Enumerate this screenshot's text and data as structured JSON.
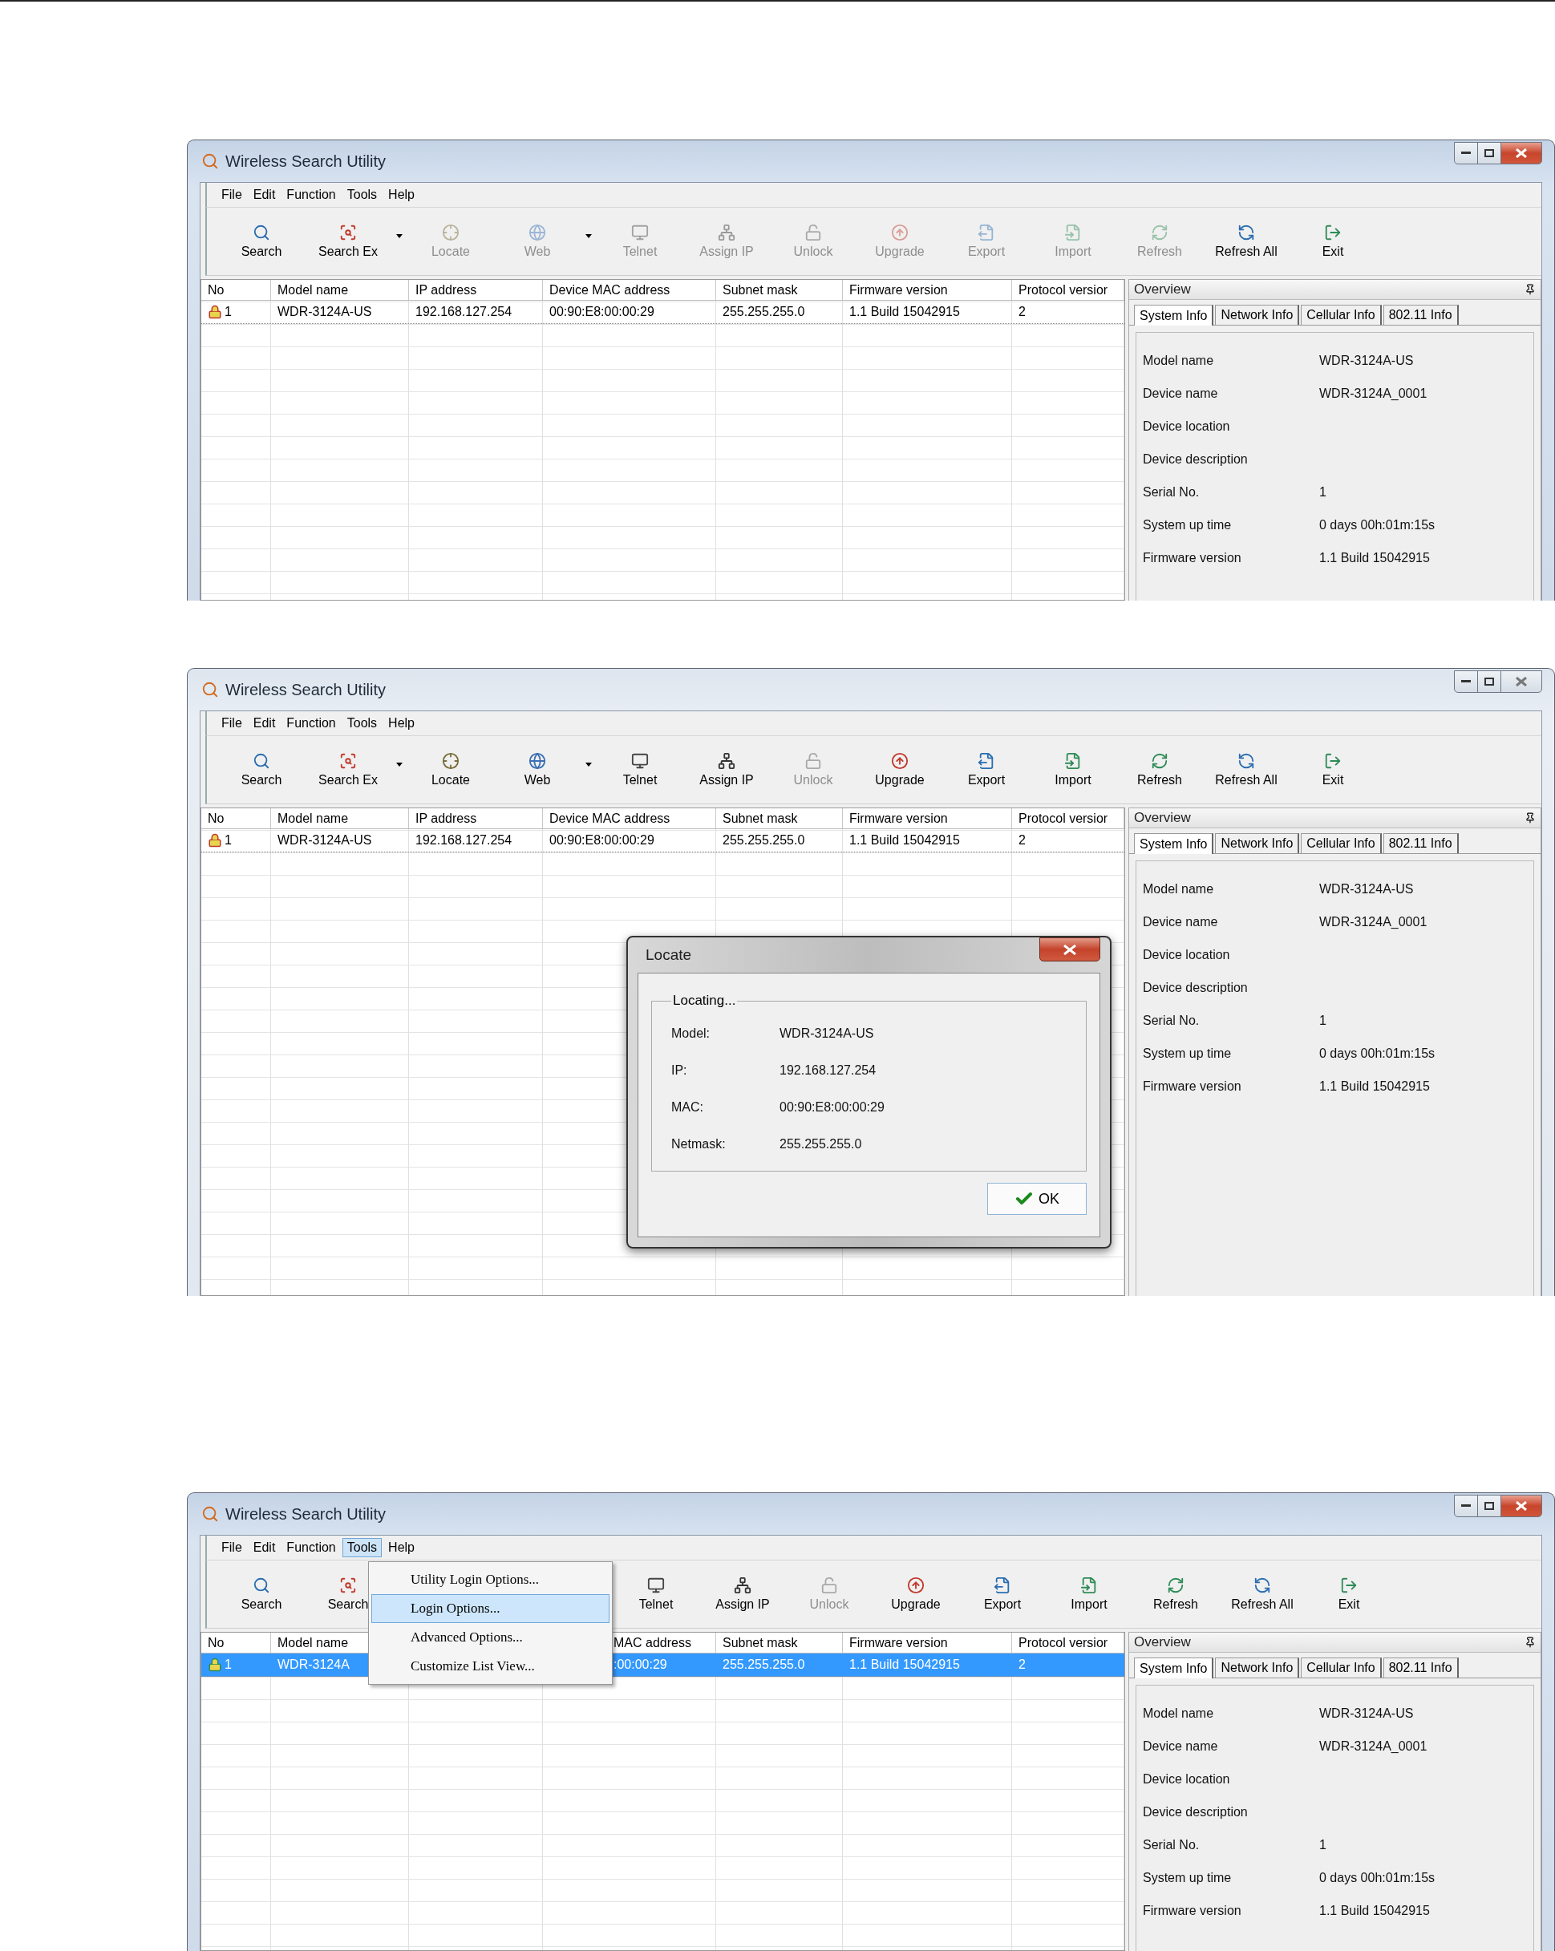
{
  "screens": [
    {
      "window": {
        "title": "Wireless Search Utility",
        "active": true
      },
      "menu": [
        {
          "label": "File",
          "open": false
        },
        {
          "label": "Edit",
          "open": false
        },
        {
          "label": "Function",
          "open": false
        },
        {
          "label": "Tools",
          "open": false
        },
        {
          "label": "Help",
          "open": false
        }
      ],
      "toolbar": [
        {
          "kind": "button",
          "label": "Search",
          "disabled": false
        },
        {
          "kind": "button",
          "label": "Search Ex",
          "disabled": false,
          "dropdown": true
        },
        {
          "kind": "button",
          "label": "Locate",
          "disabled": true
        },
        {
          "kind": "button",
          "label": "Web",
          "disabled": true,
          "dropdown": true
        },
        {
          "kind": "button",
          "label": "Telnet",
          "disabled": true
        },
        {
          "kind": "button",
          "label": "Assign IP",
          "disabled": true
        },
        {
          "kind": "button",
          "label": "Unlock",
          "disabled": true
        },
        {
          "kind": "button",
          "label": "Upgrade",
          "disabled": true
        },
        {
          "kind": "button",
          "label": "Export",
          "disabled": true
        },
        {
          "kind": "button",
          "label": "Import",
          "disabled": true
        },
        {
          "kind": "button",
          "label": "Refresh",
          "disabled": true
        },
        {
          "kind": "button",
          "label": "Refresh All",
          "disabled": false
        },
        {
          "kind": "button",
          "label": "Exit",
          "disabled": false
        }
      ],
      "table": {
        "columns": [
          {
            "label": "No",
            "covered": false
          },
          {
            "label": "Model name",
            "covered": false
          },
          {
            "label": "IP address",
            "covered": false
          },
          {
            "label": "Device MAC address",
            "covered": false
          },
          {
            "label": "Subnet mask",
            "covered": false
          },
          {
            "label": "Firmware version",
            "covered": false
          },
          {
            "label": "Protocol versior",
            "covered": false
          }
        ],
        "rows": [
          {
            "selected": false,
            "locked": true,
            "cells": [
              "1",
              "WDR-3124A-US",
              "192.168.127.254",
              "00:90:E8:00:00:29",
              "255.255.255.0",
              "1.1 Build 15042915",
              "2"
            ]
          }
        ]
      },
      "overview": {
        "title": "Overview",
        "tabs": [
          {
            "label": "System Info",
            "selected": true
          },
          {
            "label": "Network Info",
            "selected": false
          },
          {
            "label": "Cellular Info",
            "selected": false
          },
          {
            "label": "802.11 Info",
            "selected": false
          }
        ],
        "fields": [
          {
            "label": "Model name",
            "value": "WDR-3124A-US"
          },
          {
            "label": "Device name",
            "value": "WDR-3124A_0001"
          },
          {
            "label": "Device location"
          },
          {
            "label": "Device description"
          },
          {
            "label": "Serial No.",
            "value": "1"
          },
          {
            "label": "System up time",
            "value": "0 days 00h:01m:15s"
          },
          {
            "label": "Firmware version",
            "value": "1.1 Build 15042915"
          }
        ]
      }
    },
    {
      "window": {
        "title": "Wireless Search Utility",
        "active": false
      },
      "menu": [
        {
          "label": "File",
          "open": false
        },
        {
          "label": "Edit",
          "open": false
        },
        {
          "label": "Function",
          "open": false
        },
        {
          "label": "Tools",
          "open": false
        },
        {
          "label": "Help",
          "open": false
        }
      ],
      "toolbar": [
        {
          "kind": "button",
          "label": "Search",
          "disabled": false
        },
        {
          "kind": "button",
          "label": "Search Ex",
          "disabled": false,
          "dropdown": true
        },
        {
          "kind": "button",
          "label": "Locate",
          "disabled": false
        },
        {
          "kind": "button",
          "label": "Web",
          "disabled": false,
          "dropdown": true
        },
        {
          "kind": "button",
          "label": "Telnet",
          "disabled": false
        },
        {
          "kind": "button",
          "label": "Assign IP",
          "disabled": false
        },
        {
          "kind": "button",
          "label": "Unlock",
          "disabled": true
        },
        {
          "kind": "button",
          "label": "Upgrade",
          "disabled": false
        },
        {
          "kind": "button",
          "label": "Export",
          "disabled": false
        },
        {
          "kind": "button",
          "label": "Import",
          "disabled": false
        },
        {
          "kind": "button",
          "label": "Refresh",
          "disabled": false
        },
        {
          "kind": "button",
          "label": "Refresh All",
          "disabled": false
        },
        {
          "kind": "button",
          "label": "Exit",
          "disabled": false
        }
      ],
      "table": {
        "columns": [
          {
            "label": "No",
            "covered": false
          },
          {
            "label": "Model name",
            "covered": false
          },
          {
            "label": "IP address",
            "covered": false
          },
          {
            "label": "Device MAC address",
            "covered": false
          },
          {
            "label": "Subnet mask",
            "covered": false
          },
          {
            "label": "Firmware version",
            "covered": false
          },
          {
            "label": "Protocol versior",
            "covered": false
          }
        ],
        "rows": [
          {
            "selected": false,
            "locked": true,
            "cells": [
              "1",
              "WDR-3124A-US",
              "192.168.127.254",
              "00:90:E8:00:00:29",
              "255.255.255.0",
              "1.1 Build 15042915",
              "2"
            ]
          }
        ]
      },
      "overview": {
        "title": "Overview",
        "tabs": [
          {
            "label": "System Info",
            "selected": true
          },
          {
            "label": "Network Info",
            "selected": false
          },
          {
            "label": "Cellular Info",
            "selected": false
          },
          {
            "label": "802.11 Info",
            "selected": false
          }
        ],
        "fields": [
          {
            "label": "Model name",
            "value": "WDR-3124A-US"
          },
          {
            "label": "Device name",
            "value": "WDR-3124A_0001"
          },
          {
            "label": "Device location"
          },
          {
            "label": "Device description"
          },
          {
            "label": "Serial No.",
            "value": "1"
          },
          {
            "label": "System up time",
            "value": "0 days 00h:01m:15s"
          },
          {
            "label": "Firmware version",
            "value": "1.1 Build 15042915"
          }
        ]
      },
      "dialog": {
        "title": "Locate",
        "group": "Locating...",
        "fields": [
          {
            "label": "Model:",
            "value": "WDR-3124A-US"
          },
          {
            "label": "IP:",
            "value": "192.168.127.254"
          },
          {
            "label": "MAC:",
            "value": "00:90:E8:00:00:29"
          },
          {
            "label": "Netmask:",
            "value": "255.255.255.0"
          }
        ],
        "button": "OK"
      }
    },
    {
      "window": {
        "title": "Wireless Search Utility",
        "active": true
      },
      "menu": [
        {
          "label": "File",
          "open": false
        },
        {
          "label": "Edit",
          "open": false
        },
        {
          "label": "Function",
          "open": false
        },
        {
          "label": "Tools",
          "open": true
        },
        {
          "label": "Help",
          "open": false
        }
      ],
      "dropdown": {
        "items": [
          {
            "label": "Utility Login Options...",
            "selected": false
          },
          {
            "label": "Login Options...",
            "selected": true
          },
          {
            "label": "Advanced Options...",
            "selected": false
          },
          {
            "label": "Customize List View...",
            "selected": false
          }
        ]
      },
      "toolbar": [
        {
          "kind": "button",
          "label": "Search",
          "disabled": false
        },
        {
          "kind": "button",
          "label": "Search",
          "disabled": false
        },
        {
          "kind": "covered"
        },
        {
          "kind": "covered"
        },
        {
          "kind": "button",
          "label": "Telnet",
          "disabled": false
        },
        {
          "kind": "button",
          "label": "Assign IP",
          "disabled": false
        },
        {
          "kind": "button",
          "label": "Unlock",
          "disabled": true
        },
        {
          "kind": "button",
          "label": "Upgrade",
          "disabled": false
        },
        {
          "kind": "button",
          "label": "Export",
          "disabled": false
        },
        {
          "kind": "button",
          "label": "Import",
          "disabled": false
        },
        {
          "kind": "button",
          "label": "Refresh",
          "disabled": false
        },
        {
          "kind": "button",
          "label": "Refresh All",
          "disabled": false
        },
        {
          "kind": "button",
          "label": "Exit",
          "disabled": false
        }
      ],
      "table": {
        "columns": [
          {
            "label": "No",
            "covered": false
          },
          {
            "label": "Model name",
            "covered": false
          },
          {},
          {
            "label": "MAC address",
            "covered": true
          },
          {
            "label": "Subnet mask",
            "covered": false
          },
          {
            "label": "Firmware version",
            "covered": false
          },
          {
            "label": "Protocol versior",
            "covered": false
          }
        ],
        "rows": [
          {
            "selected": true,
            "locked": false,
            "cells": [
              "1",
              "WDR-3124A",
              null,
              ":00:00:29",
              "255.255.255.0",
              "1.1 Build 15042915",
              "2"
            ]
          }
        ]
      },
      "overview": {
        "title": "Overview",
        "tabs": [
          {
            "label": "System Info",
            "selected": true
          },
          {
            "label": "Network Info",
            "selected": false
          },
          {
            "label": "Cellular Info",
            "selected": false
          },
          {
            "label": "802.11 Info",
            "selected": false
          }
        ],
        "fields": [
          {
            "label": "Model name",
            "value": "WDR-3124A-US"
          },
          {
            "label": "Device name",
            "value": "WDR-3124A_0001"
          },
          {
            "label": "Device location"
          },
          {
            "label": "Device description"
          },
          {
            "label": "Serial No.",
            "value": "1"
          },
          {
            "label": "System up time",
            "value": "0 days 00h:01m:15s"
          },
          {
            "label": "Firmware version",
            "value": "1.1 Build 15042915"
          }
        ]
      }
    }
  ]
}
